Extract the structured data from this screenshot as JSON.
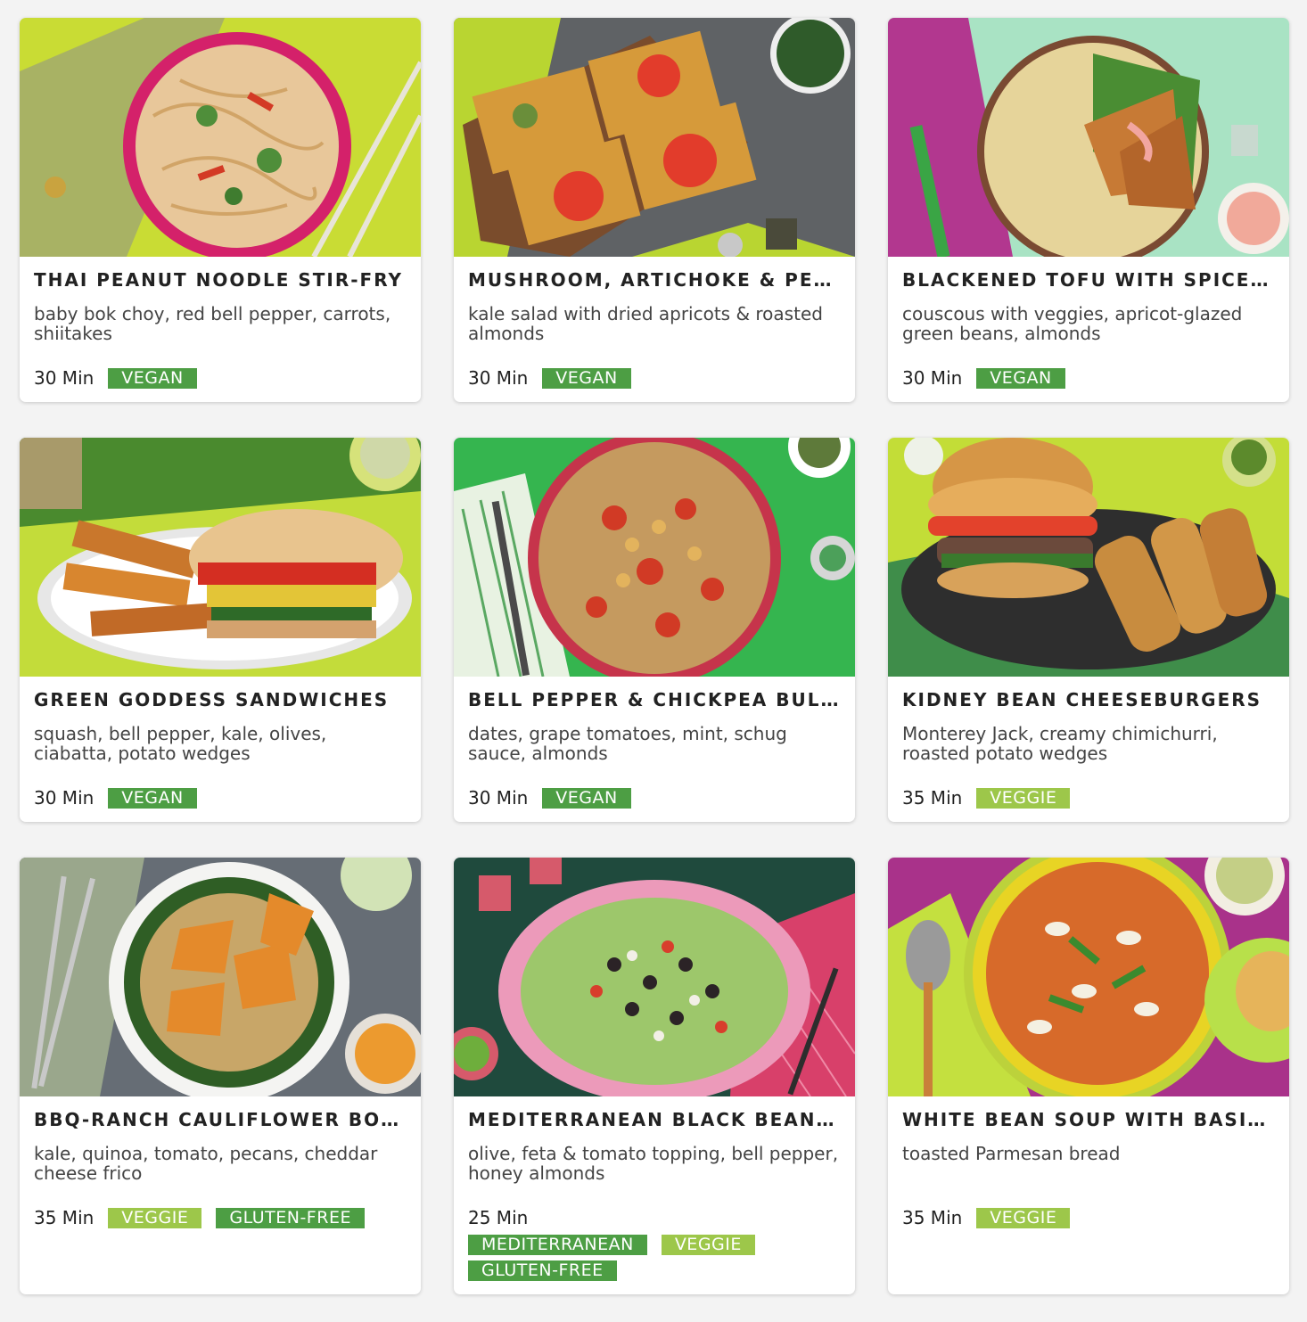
{
  "colors": {
    "page_background": "#f3f3f3",
    "card_background": "#ffffff",
    "tag_dark_green": "#4d9e44",
    "tag_light_green": "#9dc74a"
  },
  "recipes": [
    {
      "title": "THAI PEANUT NOODLE STIR-FRY",
      "description": "baby bok choy, red bell pepper, carrots, shiitakes",
      "time": "30 Min",
      "tags": [
        "VEGAN"
      ],
      "photo_icon": "noodle-bowl-photo"
    },
    {
      "title": "MUSHROOM, ARTICHOKE & PES…",
      "description": "kale salad with dried apricots & roasted almonds",
      "time": "30 Min",
      "tags": [
        "VEGAN"
      ],
      "photo_icon": "flatbread-photo"
    },
    {
      "title": "BLACKENED TOFU WITH SPICED…",
      "description": "couscous with veggies, apricot-glazed green beans, almonds",
      "time": "30 Min",
      "tags": [
        "VEGAN"
      ],
      "photo_icon": "tofu-plate-photo"
    },
    {
      "title": "GREEN GODDESS SANDWICHES",
      "description": "squash, bell pepper, kale, olives, ciabatta, potato wedges",
      "time": "30 Min",
      "tags": [
        "VEGAN"
      ],
      "photo_icon": "sandwich-plate-photo"
    },
    {
      "title": "BELL PEPPER & CHICKPEA BULG…",
      "description": "dates, grape tomatoes, mint, schug sauce, almonds",
      "time": "30 Min",
      "tags": [
        "VEGAN"
      ],
      "photo_icon": "bulgur-bowl-photo"
    },
    {
      "title": "KIDNEY BEAN CHEESEBURGERS",
      "description": "Monterey Jack, creamy chimichurri, roasted potato wedges",
      "time": "35 Min",
      "tags": [
        "VEGGIE"
      ],
      "photo_icon": "burger-plate-photo"
    },
    {
      "title": "BBQ-RANCH CAULIFLOWER BO…",
      "description": "kale, quinoa, tomato, pecans, cheddar cheese frico",
      "time": "35 Min",
      "tags": [
        "VEGGIE",
        "GLUTEN-FREE"
      ],
      "photo_icon": "cauliflower-bowl-photo"
    },
    {
      "title": "MEDITERRANEAN BLACK BEAN …",
      "description": "olive, feta & tomato topping, bell pepper, honey almonds",
      "time": "25 Min",
      "tags": [
        "MEDITERRANEAN",
        "VEGGIE",
        "GLUTEN-FREE"
      ],
      "photo_icon": "bean-salad-photo"
    },
    {
      "title": "WHITE BEAN SOUP WITH BASIL …",
      "description": "toasted Parmesan bread",
      "time": "35 Min",
      "tags": [
        "VEGGIE"
      ],
      "photo_icon": "soup-bowl-photo"
    }
  ]
}
